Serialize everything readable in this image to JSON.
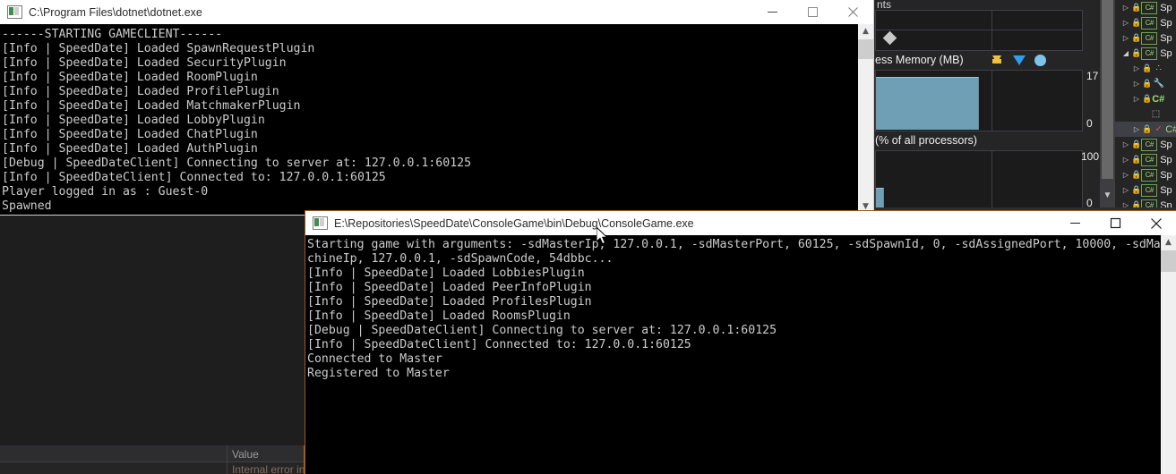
{
  "window1": {
    "title": "C:\\Program Files\\dotnet\\dotnet.exe",
    "icon_name": "console-app-icon",
    "minimize_label": "—",
    "maximize_label": "□",
    "close_label": "✕",
    "lines": [
      "------STARTING GAMECLIENT------",
      "[Info | SpeedDate] Loaded SpawnRequestPlugin",
      "[Info | SpeedDate] Loaded SecurityPlugin",
      "[Info | SpeedDate] Loaded RoomPlugin",
      "[Info | SpeedDate] Loaded ProfilePlugin",
      "[Info | SpeedDate] Loaded MatchmakerPlugin",
      "[Info | SpeedDate] Loaded LobbyPlugin",
      "[Info | SpeedDate] Loaded ChatPlugin",
      "[Info | SpeedDate] Loaded AuthPlugin",
      "[Debug | SpeedDateClient] Connecting to server at: 127.0.0.1:60125",
      "[Info | SpeedDateClient] Connected to: 127.0.0.1:60125",
      "Player logged in as : Guest-0",
      "Spawned"
    ],
    "scroll_up_glyph": "▲",
    "scroll_down_glyph": "▼"
  },
  "window2": {
    "title": "E:\\Repositories\\SpeedDate\\ConsoleGame\\bin\\Debug\\ConsoleGame.exe",
    "icon_name": "console-app-icon",
    "minimize_label": "—",
    "maximize_label": "□",
    "close_label": "✕",
    "lines": [
      "Starting game with arguments: -sdMasterIp, 127.0.0.1, -sdMasterPort, 60125, -sdSpawnId, 0, -sdAssignedPort, 10000, -sdMa",
      "chineIp, 127.0.0.1, -sdSpawnCode, 54dbbc...",
      "[Info | SpeedDate] Loaded LobbiesPlugin",
      "[Info | SpeedDate] Loaded PeerInfoPlugin",
      "[Info | SpeedDate] Loaded ProfilesPlugin",
      "[Info | SpeedDate] Loaded RoomsPlugin",
      "[Debug | SpeedDateClient] Connecting to server at: 127.0.0.1:60125",
      "[Info | SpeedDateClient] Connected to: 127.0.0.1:60125",
      "Connected to Master",
      "Registered to Master"
    ],
    "scroll_up_glyph": "▲"
  },
  "diagnostics": {
    "events_header": "nts",
    "memory_title": "ess Memory (MB)",
    "memory_axis_max": "17",
    "memory_axis_min": "0",
    "cpu_title": "(% of all processors)",
    "cpu_axis_max": "100",
    "cpu_axis_min": "0",
    "legend": [
      {
        "name": "snapshot-pin-marker",
        "label": ""
      },
      {
        "name": "memory-marker",
        "label": ""
      },
      {
        "name": "allocation-dot-marker",
        "label": ""
      }
    ],
    "colors": {
      "memory_fill": "#6f9fb5",
      "marker_yellow": "#f0c040",
      "marker_blue": "#2e9df2",
      "marker_dot": "#7fc3e8",
      "panel_bg": "#252526",
      "chart_bg": "#1b1b1c",
      "accent_orange": "#b05a17"
    }
  },
  "solution_explorer": {
    "rows": [
      {
        "label": "Sp",
        "state": "collapsed",
        "kind": "csharp-project",
        "selected": false
      },
      {
        "label": "Sp",
        "state": "collapsed",
        "kind": "csharp-project",
        "selected": false
      },
      {
        "label": "Sp",
        "state": "collapsed",
        "kind": "csharp-project",
        "selected": false
      },
      {
        "label": "Sp",
        "state": "expanded",
        "kind": "csharp-project",
        "selected": false
      },
      {
        "label": "",
        "state": "collapsed",
        "kind": "references",
        "selected": false
      },
      {
        "label": "",
        "state": "collapsed",
        "kind": "properties-wrench",
        "selected": false
      },
      {
        "label": "C#",
        "state": "collapsed",
        "kind": "csharp-folder",
        "selected": false
      },
      {
        "label": "",
        "state": "none",
        "kind": "code-file",
        "selected": false
      },
      {
        "label": "C#",
        "state": "collapsed",
        "kind": "csharp-file-modified",
        "selected": true
      },
      {
        "label": "Sp",
        "state": "collapsed",
        "kind": "csharp-project",
        "selected": false
      },
      {
        "label": "Sp",
        "state": "collapsed",
        "kind": "csharp-project",
        "selected": false
      },
      {
        "label": "Sp",
        "state": "collapsed",
        "kind": "csharp-project",
        "selected": false
      },
      {
        "label": "Sp",
        "state": "collapsed",
        "kind": "csharp-project",
        "selected": false
      },
      {
        "label": "Sp",
        "state": "collapsed",
        "kind": "csharp-project",
        "selected": false
      }
    ]
  },
  "bottom_panel": {
    "value_column_header": "Value",
    "first_cell_text": "Internal error in"
  }
}
